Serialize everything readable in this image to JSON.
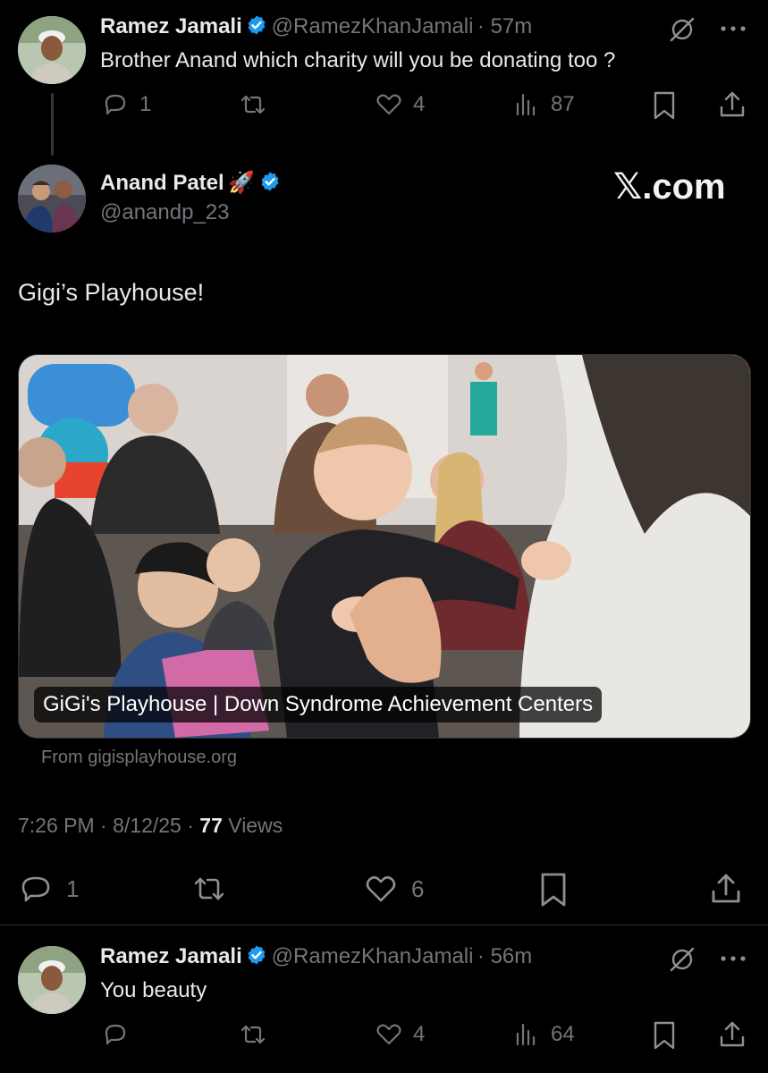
{
  "reply1": {
    "name": "Ramez Jamali",
    "handle": "@RamezKhanJamali",
    "time": "· 57m",
    "text": "Brother Anand which charity will you be donating too ?",
    "replies": "1",
    "likes": "4",
    "views": "87"
  },
  "main_tweet": {
    "name": "Anand Patel",
    "name_emoji": "🚀",
    "handle": "@anandp_23",
    "watermark": "𝕏.com",
    "text": "Gigi’s Playhouse!",
    "card_caption": "GiGi's Playhouse | Down Syndrome Achievement Centers",
    "card_source": "From gigisplayhouse.org",
    "timestamp": "7:26 PM · 8/12/25 · ",
    "views_count": "77",
    "views_label": " Views",
    "replies": "1",
    "likes": "6"
  },
  "reply2": {
    "name": "Ramez Jamali",
    "handle": "@RamezKhanJamali",
    "time": "· 56m",
    "text": "You beauty",
    "likes": "4",
    "views": "64"
  },
  "colors": {
    "background": "#000000",
    "text": "#e7e9ea",
    "muted": "#71767b",
    "verified": "#1d9bf0"
  },
  "icons": [
    "verified-badge-icon",
    "grok-icon",
    "more-icon",
    "reply-icon",
    "retweet-icon",
    "like-icon",
    "views-icon",
    "bookmark-icon",
    "share-icon",
    "rocket-emoji"
  ]
}
